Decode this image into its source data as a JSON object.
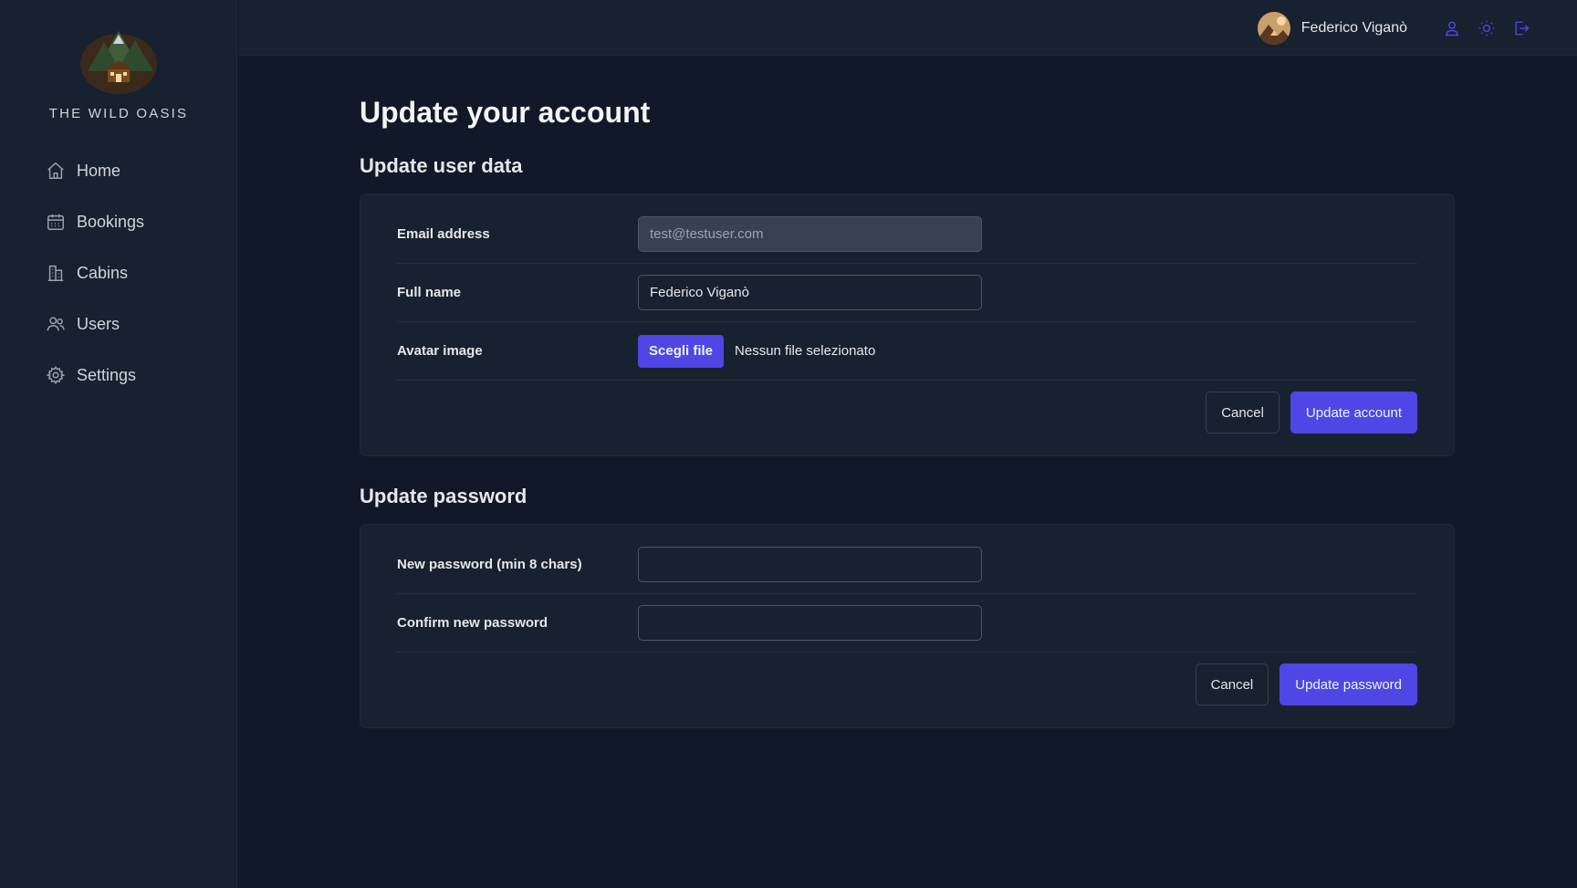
{
  "brand": {
    "name": "THE WILD OASIS"
  },
  "sidebar": {
    "items": [
      {
        "label": "Home",
        "icon": "home-icon"
      },
      {
        "label": "Bookings",
        "icon": "calendar-icon"
      },
      {
        "label": "Cabins",
        "icon": "building-icon"
      },
      {
        "label": "Users",
        "icon": "users-icon"
      },
      {
        "label": "Settings",
        "icon": "gear-icon"
      }
    ]
  },
  "header": {
    "user_name": "Federico Viganò",
    "icons": [
      "user-icon",
      "sun-icon",
      "logout-icon"
    ]
  },
  "main": {
    "title": "Update your account",
    "user_section": {
      "title": "Update user data",
      "email_label": "Email address",
      "email_value": "test@testuser.com",
      "fullname_label": "Full name",
      "fullname_value": "Federico Viganò",
      "avatar_label": "Avatar image",
      "file_button": "Scegli file",
      "file_status": "Nessun file selezionato",
      "cancel": "Cancel",
      "submit": "Update account"
    },
    "password_section": {
      "title": "Update password",
      "new_label": "New password (min 8 chars)",
      "confirm_label": "Confirm new password",
      "cancel": "Cancel",
      "submit": "Update password"
    }
  },
  "colors": {
    "accent": "#4f46e5",
    "background": "#111827",
    "panel": "#18212f"
  }
}
